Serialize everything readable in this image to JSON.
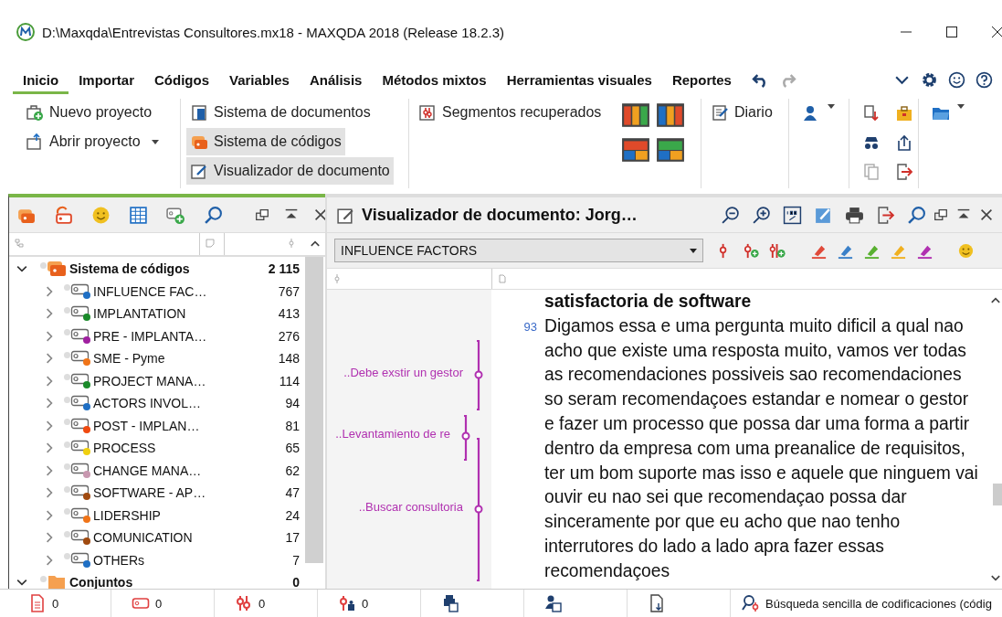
{
  "window": {
    "title": "D:\\Maxqda\\Entrevistas Consultores.mx18 - MAXQDA 2018 (Release 18.2.3)"
  },
  "menu_tabs": [
    {
      "label": "Inicio",
      "selected": true
    },
    {
      "label": "Importar",
      "selected": false
    },
    {
      "label": "Códigos",
      "selected": false
    },
    {
      "label": "Variables",
      "selected": false
    },
    {
      "label": "Análisis",
      "selected": false
    },
    {
      "label": "Métodos mixtos",
      "selected": false
    },
    {
      "label": "Herramientas visuales",
      "selected": false
    },
    {
      "label": "Reportes",
      "selected": false
    }
  ],
  "ribbon": {
    "groups": [
      {
        "items": [
          {
            "kind": "new-project",
            "label": "Nuevo proyecto",
            "active": false,
            "dropdown": false
          },
          {
            "kind": "open-project",
            "label": "Abrir proyecto",
            "active": false,
            "dropdown": true
          }
        ]
      },
      {
        "items": [
          {
            "kind": "documents",
            "label": "Sistema de documentos",
            "active": false,
            "dropdown": false
          },
          {
            "kind": "codes",
            "label": "Sistema de códigos",
            "active": true,
            "dropdown": false
          },
          {
            "kind": "viewer",
            "label": "Visualizador de documento",
            "active": true,
            "dropdown": false
          }
        ]
      },
      {
        "items": [
          {
            "kind": "segments",
            "label": "Segmentos recuperados",
            "active": false,
            "dropdown": false
          }
        ]
      },
      {
        "items": [
          {
            "kind": "diary",
            "label": "Diario",
            "active": false,
            "dropdown": false
          }
        ]
      }
    ]
  },
  "code_system": {
    "root": {
      "label": "Sistema de códigos",
      "count": "2 115",
      "expanded": true,
      "children": [
        {
          "label": "INFLUENCE FAC…",
          "count": "767",
          "color": "#1f6fc4",
          "expanded": false
        },
        {
          "label": "IMPLANTATION",
          "count": "413",
          "color": "#1a8a2a",
          "expanded": false
        },
        {
          "label": "PRE - IMPLANTA…",
          "count": "276",
          "color": "#a020a0",
          "expanded": false
        },
        {
          "label": "SME - Pyme",
          "count": "148",
          "color": "#f07418",
          "expanded": false
        },
        {
          "label": "PROJECT MANA…",
          "count": "114",
          "color": "#1a8a2a",
          "expanded": false
        },
        {
          "label": "ACTORS INVOL…",
          "count": "94",
          "color": "#1f6fc4",
          "expanded": false
        },
        {
          "label": "POST - IMPLAN…",
          "count": "81",
          "color": "#f04a10",
          "expanded": false
        },
        {
          "label": "PROCESS",
          "count": "65",
          "color": "#f0d010",
          "expanded": false
        },
        {
          "label": "CHANGE MANA…",
          "count": "62",
          "color": "#c898b0",
          "expanded": false
        },
        {
          "label": "SOFTWARE - AP…",
          "count": "47",
          "color": "#a04a10",
          "expanded": false
        },
        {
          "label": "LIDERSHIP",
          "count": "24",
          "color": "#f07418",
          "expanded": false
        },
        {
          "label": "COMUNICATION",
          "count": "17",
          "color": "#a04a10",
          "expanded": false
        },
        {
          "label": "OTHERs",
          "count": "7",
          "color": "#1f6fc4",
          "expanded": false
        }
      ]
    },
    "sets": {
      "label": "Conjuntos",
      "count": "0",
      "expanded": true
    }
  },
  "document_viewer": {
    "title": "Visualizador de documento: Jorg…",
    "code_dropdown": {
      "value": "INFLUENCE FACTORS"
    },
    "memo_segments": [
      {
        "label": "..Debe exstir un gestor"
      },
      {
        "label": "..Levantamiento de re"
      },
      {
        "label": "..Buscar consultoria"
      }
    ],
    "paragraphs": [
      {
        "text": "satisfactoria de software",
        "bold": true
      },
      {
        "number": "93",
        "text": "Digamos essa e uma pergunta muito dificil a qual nao acho que existe uma resposta muito, vamos ver todas as recomendaciones possiveis sao recomendaciones so seram recomendaçoes estandar e nomear o gestor e fazer um processo que possa dar uma forma a partir dentro da empresa com uma preanalice de requisitos, ter um bom suporte mas isso e aquele que ninguem vai ouvir eu nao sei que recomendaçao possa dar sinceramente por que eu acho que nao tenho interrutores do lado a lado apra fazer essas recomendaçoes",
        "bold": false
      }
    ]
  },
  "status_bar": [
    {
      "kind": "documents",
      "count": "0"
    },
    {
      "kind": "codes",
      "count": "0"
    },
    {
      "kind": "segments",
      "count": "0"
    },
    {
      "kind": "coded",
      "count": "0"
    },
    {
      "kind": "variables"
    },
    {
      "kind": "doc-variables"
    },
    {
      "kind": "import"
    },
    {
      "kind": "search",
      "label": "Búsqueda sencilla de codificaciones (códig"
    }
  ]
}
